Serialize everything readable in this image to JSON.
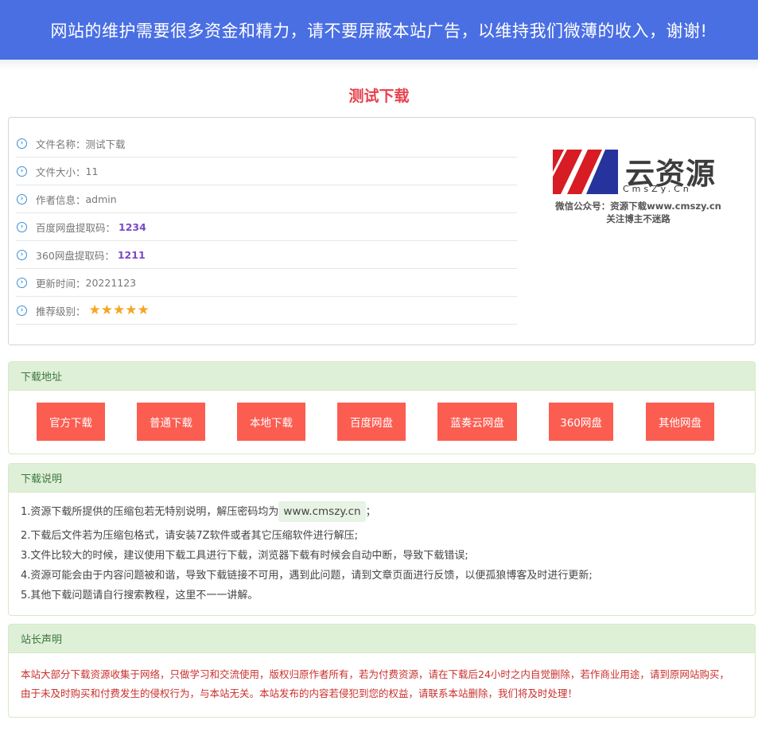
{
  "banner": {
    "text": "网站的维护需要很多资金和精力，请不要屏蔽本站广告，以维持我们微薄的收入，谢谢!"
  },
  "page": {
    "title": "测试下载"
  },
  "info": {
    "rows": [
      {
        "label": "文件名称：",
        "value": "测试下载"
      },
      {
        "label": "文件大小：",
        "value": "11"
      },
      {
        "label": "作者信息：",
        "value": "admin"
      },
      {
        "label": "百度网盘提取码：",
        "value": "1234"
      },
      {
        "label": "360网盘提取码：",
        "value": "1211"
      },
      {
        "label": "更新时间：",
        "value": "20221123"
      },
      {
        "label": "推荐级别：",
        "value": "★★★★★"
      }
    ],
    "rating": 5
  },
  "logo": {
    "brand": "云资源",
    "sub": "CmsZy.Cn",
    "caption_line1": "微信公众号：资源下载www.cmszy.cn",
    "caption_line2": "关注博主不迷路"
  },
  "download": {
    "title": "下载地址",
    "buttons": [
      "官方下载",
      "普通下载",
      "本地下载",
      "百度网盘",
      "蓝奏云网盘",
      "360网盘",
      "其他网盘"
    ]
  },
  "notes": {
    "title": "下载说明",
    "line1_pre": "1.资源下载所提供的压缩包若无特别说明，解压密码均为",
    "line1_code": "www.cmszy.cn",
    "line1_post": "；",
    "line2": "2.下载后文件若为压缩包格式，请安装7Z软件或者其它压缩软件进行解压;",
    "line3": "3.文件比较大的时候，建议使用下载工具进行下载，浏览器下载有时候会自动中断，导致下载错误;",
    "line4": "4.资源可能会由于内容问题被和谐，导致下载链接不可用，遇到此问题，请到文章页面进行反馈，以便孤狼博客及时进行更新;",
    "line5": "5.其他下载问题请自行搜索教程，这里不一一讲解。"
  },
  "statement": {
    "title": "站长声明",
    "text": "本站大部分下载资源收集于网络，只做学习和交流使用，版权归原作者所有，若为付费资源，请在下载后24小时之内自觉删除，若作商业用途，请到原网站购买，由于未及时购买和付费发生的侵权行为，与本站无关。本站发布的内容若侵犯到您的权益，请联系本站删除，我们将及时处理！"
  },
  "colors": {
    "banner": "#4a6fe3",
    "title": "#e8414e",
    "button": "#fb5d51",
    "panel_head": "#dff0d8",
    "panel_head_text": "#3c763d",
    "code": "#7a49c9",
    "star": "#f5a623",
    "statement": "#c9302c"
  }
}
